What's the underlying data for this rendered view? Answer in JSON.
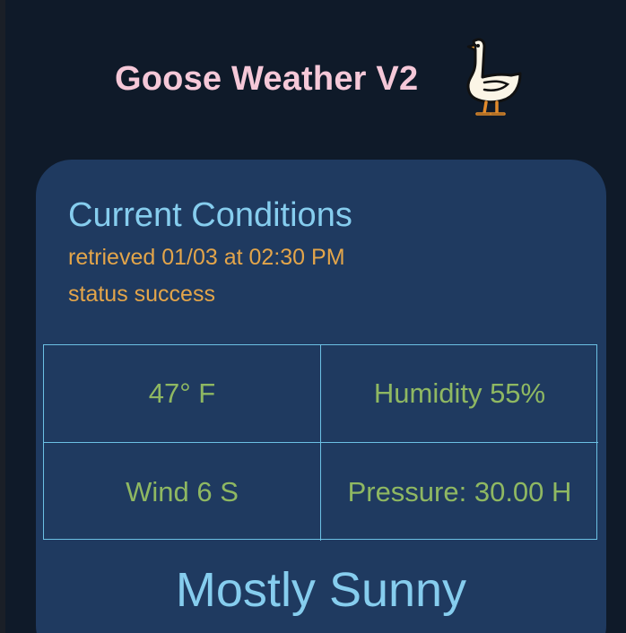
{
  "app": {
    "title": "Goose Weather V2",
    "logo_icon": "goose-icon"
  },
  "conditions": {
    "heading": "Current Conditions",
    "retrieved": "retrieved 01/03 at 02:30 PM",
    "status": "status success",
    "temperature": "47° F",
    "humidity": "Humidity 55%",
    "wind": "Wind 6 S",
    "pressure": "Pressure: 30.00 H",
    "summary": "Mostly Sunny"
  },
  "colors": {
    "background": "#0f1a29",
    "card": "#1f3a60",
    "title": "#f5c8d8",
    "heading": "#86cdee",
    "meta": "#e3a54a",
    "values": "#8fb862",
    "grid_border": "#6cc0e4"
  }
}
